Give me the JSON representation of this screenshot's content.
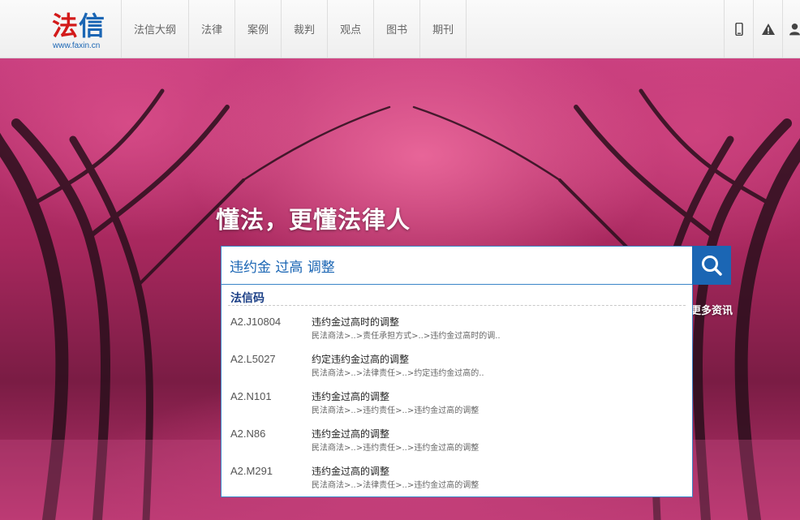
{
  "header": {
    "logo_text_red": "法",
    "logo_text_blue": "信",
    "logo_url": "www.faxin.cn",
    "nav": [
      "法信大纲",
      "法律",
      "案例",
      "裁判",
      "观点",
      "图书",
      "期刊"
    ],
    "icons": [
      "mobile-icon",
      "warning-icon",
      "user-icon"
    ]
  },
  "hero": {
    "slogan": "懂法，更懂法律人",
    "more_link": "更多资讯"
  },
  "search": {
    "value": "违约金 过高 调整",
    "button_icon": "search-icon"
  },
  "suggestions": {
    "header": "法信码",
    "items": [
      {
        "code": "A2.J10804",
        "title": "违约金过高时的调整",
        "path": "民法商法>..>责任承担方式>..>违约金过高时的调.."
      },
      {
        "code": "A2.L5027",
        "title": "约定违约金过高的调整",
        "path": "民法商法>..>法律责任>..>约定违约金过高的.."
      },
      {
        "code": "A2.N101",
        "title": "违约金过高的调整",
        "path": "民法商法>..>违约责任>..>违约金过高的调整"
      },
      {
        "code": "A2.N86",
        "title": "违约金过高的调整",
        "path": "民法商法>..>违约责任>..>违约金过高的调整"
      },
      {
        "code": "A2.M291",
        "title": "违约金过高的调整",
        "path": "民法商法>..>法律责任>..>违约金过高的调整"
      }
    ]
  },
  "colors": {
    "brand_red": "#d31a1a",
    "brand_blue": "#1b66b4",
    "hero_pink": "#c93f7f"
  }
}
